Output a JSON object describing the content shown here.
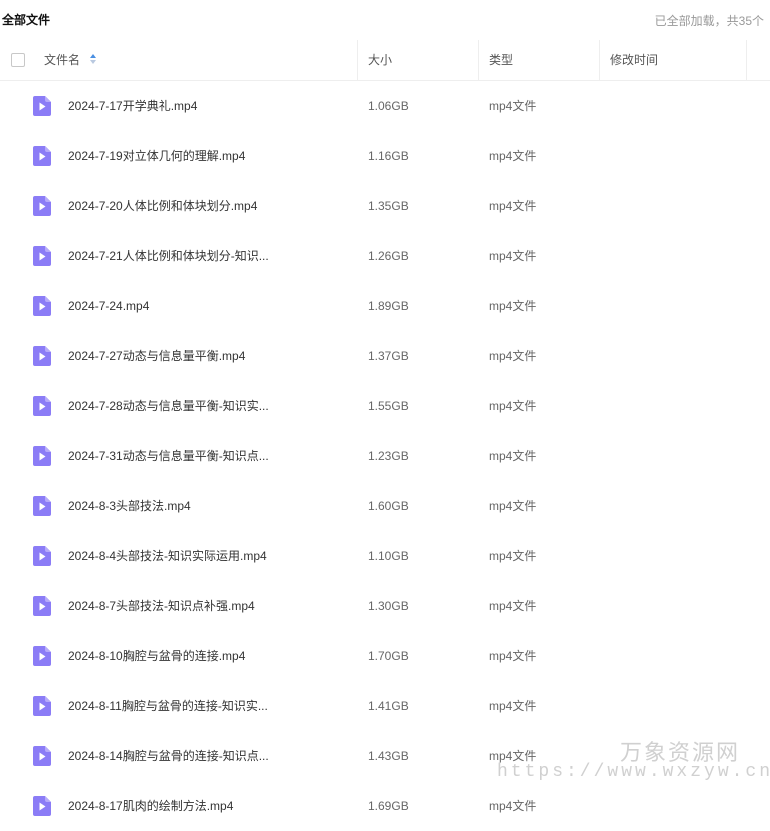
{
  "header": {
    "title": "全部文件",
    "loaded_text": "已全部加载，共35个"
  },
  "columns": {
    "name": "文件名",
    "size": "大小",
    "type": "类型",
    "modified": "修改时间"
  },
  "accent_color": "#8b7cf6",
  "icon": "video-file-icon",
  "files": [
    {
      "name": "2024-7-17开学典礼.mp4",
      "size": "1.06GB",
      "type": "mp4文件"
    },
    {
      "name": "2024-7-19对立体几何的理解.mp4",
      "size": "1.16GB",
      "type": "mp4文件"
    },
    {
      "name": "2024-7-20人体比例和体块划分.mp4",
      "size": "1.35GB",
      "type": "mp4文件"
    },
    {
      "name": "2024-7-21人体比例和体块划分-知识...",
      "size": "1.26GB",
      "type": "mp4文件"
    },
    {
      "name": "2024-7-24.mp4",
      "size": "1.89GB",
      "type": "mp4文件"
    },
    {
      "name": "2024-7-27动态与信息量平衡.mp4",
      "size": "1.37GB",
      "type": "mp4文件"
    },
    {
      "name": "2024-7-28动态与信息量平衡-知识实...",
      "size": "1.55GB",
      "type": "mp4文件"
    },
    {
      "name": "2024-7-31动态与信息量平衡-知识点...",
      "size": "1.23GB",
      "type": "mp4文件"
    },
    {
      "name": "2024-8-3头部技法.mp4",
      "size": "1.60GB",
      "type": "mp4文件"
    },
    {
      "name": "2024-8-4头部技法-知识实际运用.mp4",
      "size": "1.10GB",
      "type": "mp4文件"
    },
    {
      "name": "2024-8-7头部技法-知识点补强.mp4",
      "size": "1.30GB",
      "type": "mp4文件"
    },
    {
      "name": "2024-8-10胸腔与盆骨的连接.mp4",
      "size": "1.70GB",
      "type": "mp4文件"
    },
    {
      "name": "2024-8-11胸腔与盆骨的连接-知识实...",
      "size": "1.41GB",
      "type": "mp4文件"
    },
    {
      "name": "2024-8-14胸腔与盆骨的连接-知识点...",
      "size": "1.43GB",
      "type": "mp4文件"
    },
    {
      "name": "2024-8-17肌肉的绘制方法.mp4",
      "size": "1.69GB",
      "type": "mp4文件"
    }
  ],
  "watermark": {
    "line1": "万象资源网",
    "line2": "https://www.wxzyw.cn"
  }
}
